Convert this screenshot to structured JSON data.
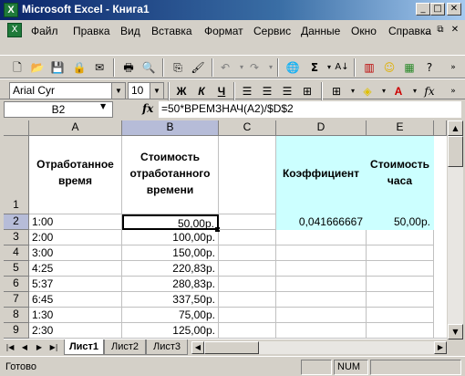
{
  "window": {
    "title": "Microsoft Excel - Книга1",
    "app_icon": "X"
  },
  "menu": [
    "Файл",
    "Правка",
    "Вид",
    "Вставка",
    "Формат",
    "Сервис",
    "Данные",
    "Окно",
    "Справка"
  ],
  "format_toolbar": {
    "font": "Arial Cyr",
    "size": "10",
    "bold": "Ж",
    "italic": "К",
    "underline": "Ч"
  },
  "formula_bar": {
    "name_box": "B2",
    "fx": "fx",
    "formula": "=50*ВРЕМЗНАЧ(A2)/$D$2"
  },
  "columns": [
    "A",
    "B",
    "C",
    "D",
    "E"
  ],
  "rows": [
    "1",
    "2",
    "3",
    "4",
    "5",
    "6",
    "7",
    "8",
    "9"
  ],
  "cells": {
    "A1": "Отработанное время",
    "B1": "Стоимость отработанного времени",
    "D1": "Коэффициент",
    "E1": "Стоимость часа",
    "A": [
      "1:00",
      "2:00",
      "3:00",
      "4:25",
      "5:37",
      "6:45",
      "1:30",
      "2:30"
    ],
    "B": [
      "50,00р.",
      "100,00р.",
      "150,00р.",
      "220,83р.",
      "280,83р.",
      "337,50р.",
      "75,00р.",
      "125,00р."
    ],
    "D2": "0,041666667",
    "E2": "50,00р."
  },
  "sheets": [
    "Лист1",
    "Лист2",
    "Лист3"
  ],
  "status": {
    "ready": "Готово",
    "num": "NUM"
  },
  "colors": {
    "title_gradient_start": "#0a246a",
    "highlight_cyan": "#ccffff",
    "selected_header": "#b6bcd8"
  }
}
